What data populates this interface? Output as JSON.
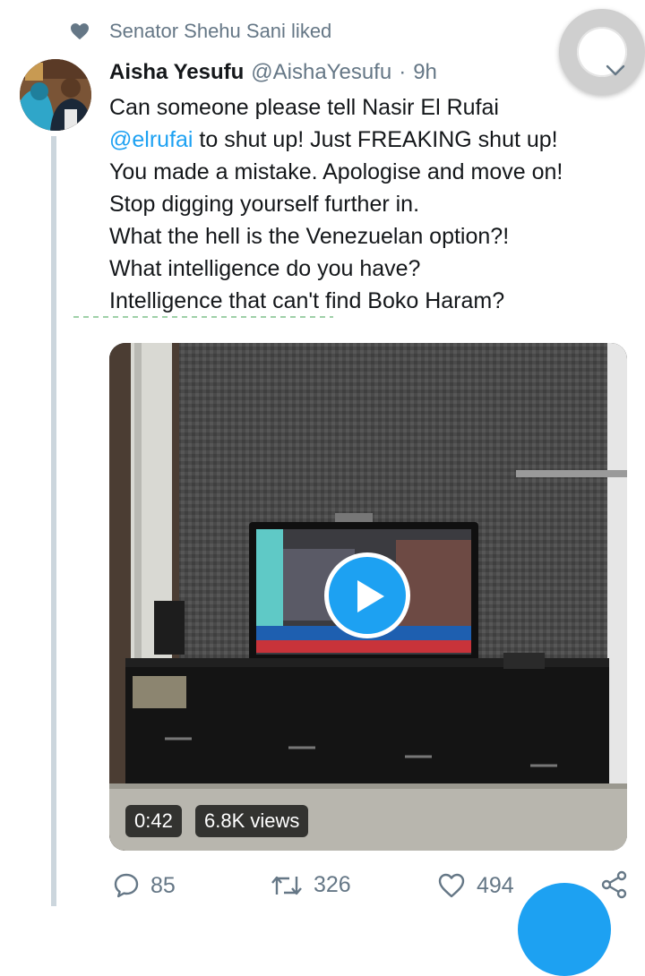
{
  "social_context": {
    "text": "Senator Shehu Sani liked",
    "icon": "heart-icon"
  },
  "tweet": {
    "author_name": "Aisha Yesufu",
    "handle": "@AishaYesufu",
    "separator": "·",
    "time": "9h",
    "text_lines": [
      {
        "prefix": "Can someone please tell Nasir El Rufai",
        "mention": "",
        "suffix": ""
      },
      {
        "prefix": "",
        "mention": "@elrufai",
        "suffix": " to shut up! Just FREAKING shut up!"
      },
      {
        "prefix": "You made a mistake. Apologise and move on!",
        "mention": "",
        "suffix": ""
      },
      {
        "prefix": "Stop digging yourself further in.",
        "mention": "",
        "suffix": ""
      },
      {
        "prefix": "What the hell is the Venezuelan option?!",
        "mention": "",
        "suffix": ""
      },
      {
        "prefix": "What intelligence do you have?",
        "mention": "",
        "suffix": ""
      },
      {
        "prefix": "Intelligence that can't find Boko Haram?",
        "mention": "",
        "suffix": ""
      }
    ]
  },
  "media": {
    "duration": "0:42",
    "views": "6.8K views",
    "play_icon": "play-icon"
  },
  "actions": {
    "reply_count": "85",
    "retweet_count": "326",
    "like_count": "494"
  },
  "colors": {
    "accent": "#1da1f2",
    "secondary_text": "#657786",
    "primary_text": "#14171a"
  }
}
